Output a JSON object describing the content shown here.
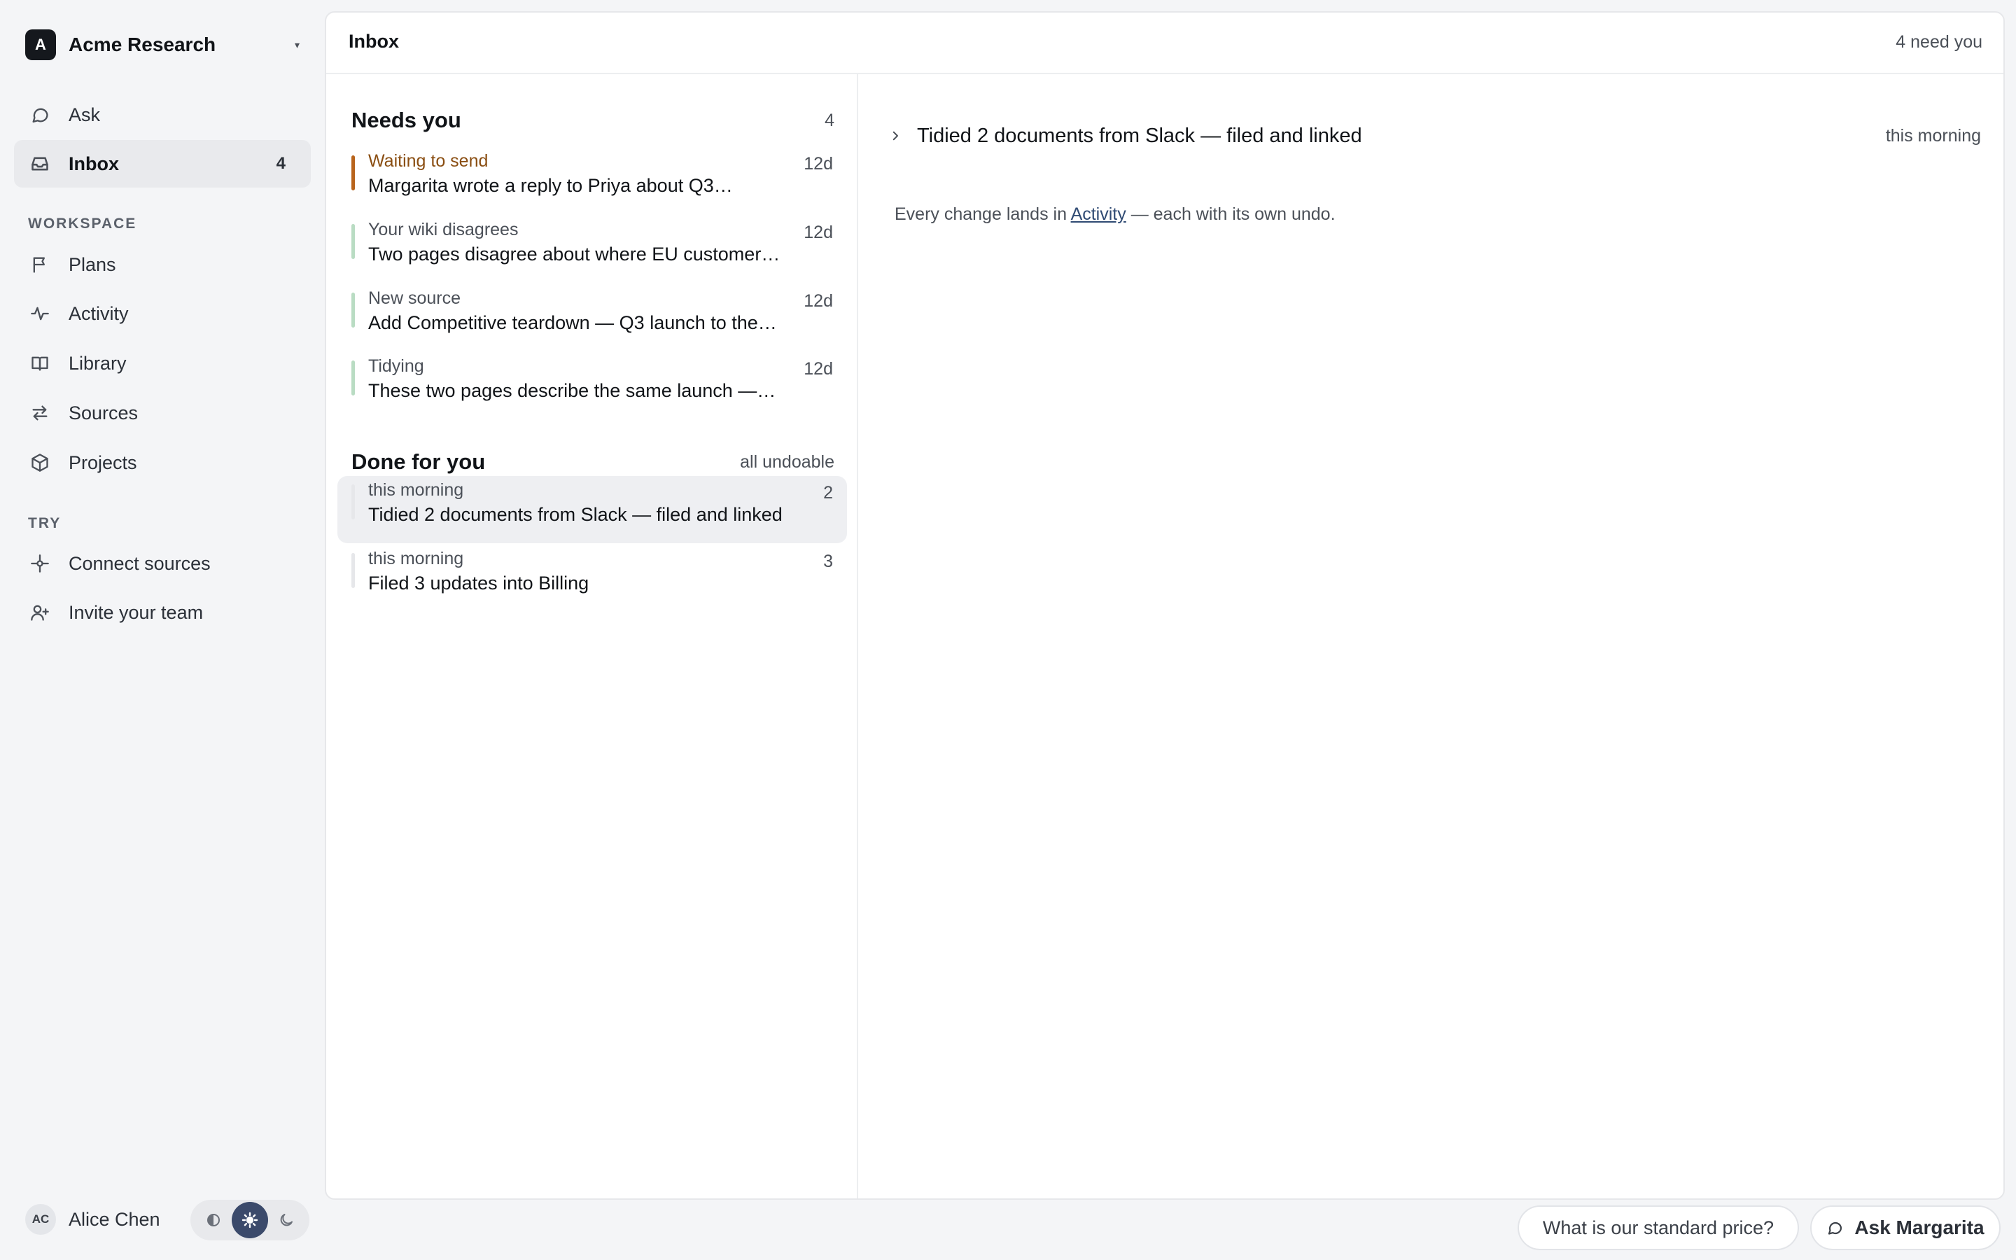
{
  "org": {
    "initial": "A",
    "name": "Acme Research",
    "caret": "▾"
  },
  "nav": {
    "ask": "Ask",
    "inbox": {
      "label": "Inbox",
      "count": "4"
    },
    "workspace_label": "WORKSPACE",
    "workspace": [
      "Plans",
      "Activity",
      "Library",
      "Sources",
      "Projects"
    ],
    "try_label": "TRY",
    "try": [
      "Connect sources",
      "Invite your team"
    ]
  },
  "user": {
    "initials": "AC",
    "name": "Alice Chen"
  },
  "theme": {
    "options": [
      "system",
      "light",
      "dark"
    ],
    "selected": "light"
  },
  "header": {
    "title": "Inbox",
    "status": "4 need you"
  },
  "needs_you": {
    "title": "Needs you",
    "count": "4",
    "items": [
      {
        "kicker": "Waiting to send",
        "title": "Margarita wrote a reply to Priya about Q3…",
        "age": "12d",
        "accent": "#b8641c"
      },
      {
        "kicker": "Your wiki disagrees",
        "title": "Two pages disagree about where EU customer…",
        "age": "12d",
        "accent": "#b9dcc3"
      },
      {
        "kicker": "New source",
        "title": "Add Competitive teardown — Q3 launch to the…",
        "age": "12d",
        "accent": "#b9dcc3"
      },
      {
        "kicker": "Tidying",
        "title": "These two pages describe the same launch —…",
        "age": "12d",
        "accent": "#b9dcc3"
      }
    ]
  },
  "done_for_you": {
    "title": "Done for you",
    "meta": "all undoable",
    "items": [
      {
        "kicker": "this morning",
        "title": "Tidied 2 documents from Slack — filed and linked",
        "age": "2",
        "accent": "#e6e7ea"
      },
      {
        "kicker": "this morning",
        "title": "Filed 3 updates into Billing",
        "age": "3",
        "accent": "#e6e7ea"
      }
    ]
  },
  "detail": {
    "title": "Tidied 2 documents from Slack — filed and linked",
    "time": "this morning",
    "body_prefix": "Every change lands in ",
    "body_link": "Activity",
    "body_suffix": " — each with its own undo."
  },
  "bottom": {
    "suggestion": "What is our standard price?",
    "ask_label": "Ask Margarita"
  },
  "colors": {
    "waiting_accent": "#b8641c",
    "kicker_waiting": "#8a4e12",
    "theme_active": "#3b4a6b"
  }
}
